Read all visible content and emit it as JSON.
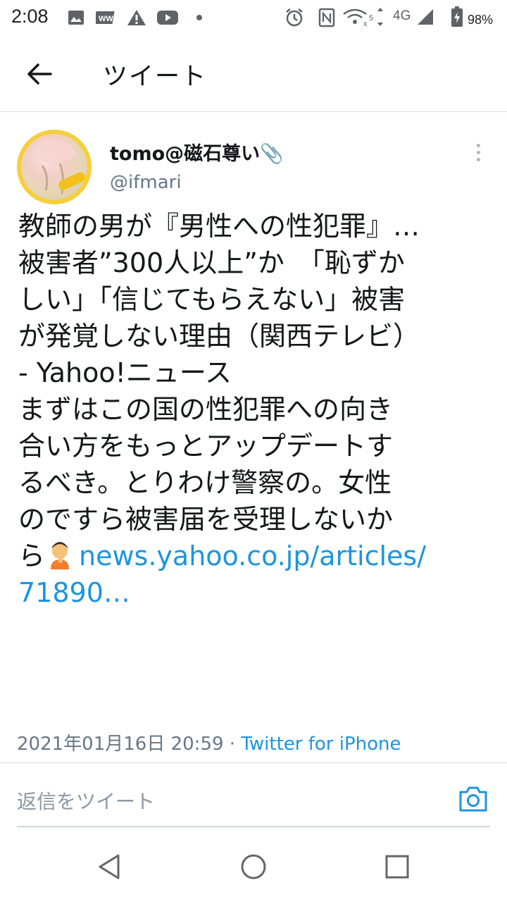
{
  "status_bar": {
    "time": "2:08",
    "network": "4G",
    "battery": "98%",
    "icons": [
      "image-icon",
      "news-icon",
      "warning-icon",
      "youtube-icon",
      "dot-icon",
      "alarm-icon",
      "nfc-icon",
      "wifi-icon",
      "signal-icon",
      "battery-icon"
    ]
  },
  "header": {
    "title": "ツイート",
    "back_icon": "arrow-left-icon"
  },
  "tweet": {
    "display_name": "tomo@磁石尊い📎",
    "handle": "@ifmari",
    "text_lines": [
      "教師の男が『男性への性犯罪』…",
      "被害者”300人以上”か　「恥ずか",
      "しい」「信じてもらえない」被害",
      "が発覚しない理由（関西テレビ）",
      "- Yahoo!ニュース",
      "まずはこの国の性犯罪への向き",
      "合い方をもっとアップデートす",
      "るべき。とりわけ警察の。女性",
      "のですら被害届を受理しないか"
    ],
    "last_line_prefix": "ら",
    "link_part1": "news.yahoo.co.jp/articles/",
    "link_part2": "71890…",
    "timestamp": "2021年01月16日 20:59",
    "separator": "·",
    "source": "Twitter for iPhone"
  },
  "reply": {
    "placeholder": "返信をツイート"
  },
  "colors": {
    "link": "#1b95e0",
    "secondary_text": "#657786",
    "avatar_ring": "#f7cf3a"
  }
}
